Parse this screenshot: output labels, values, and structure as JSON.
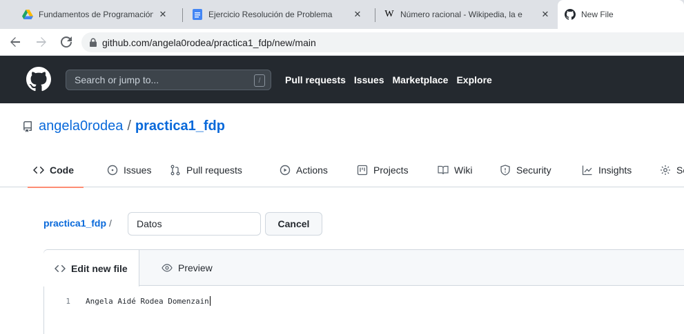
{
  "browser": {
    "tabs": [
      {
        "title": "Fundamentos de Programación -",
        "icon": "google-drive-icon"
      },
      {
        "title": "Ejercicio Resolución de Problema",
        "icon": "google-docs-icon"
      },
      {
        "title": "Número racional - Wikipedia, la e",
        "icon": "wikipedia-icon"
      },
      {
        "title": "New File",
        "icon": "github-icon"
      }
    ],
    "tab_close_glyph": "✕",
    "url": "github.com/angela0rodea/practica1_fdp/new/main"
  },
  "github_header": {
    "search_placeholder": "Search or jump to...",
    "search_shortcut": "/",
    "nav": [
      "Pull requests",
      "Issues",
      "Marketplace",
      "Explore"
    ]
  },
  "repo": {
    "owner": "angela0rodea",
    "separator": "/",
    "name": "practica1_fdp",
    "tabs": [
      {
        "label": "Code",
        "icon": "code-icon"
      },
      {
        "label": "Issues",
        "icon": "issue-opened-icon"
      },
      {
        "label": "Pull requests",
        "icon": "git-pull-request-icon"
      },
      {
        "label": "Actions",
        "icon": "play-icon"
      },
      {
        "label": "Projects",
        "icon": "project-icon"
      },
      {
        "label": "Wiki",
        "icon": "book-icon"
      },
      {
        "label": "Security",
        "icon": "shield-icon"
      },
      {
        "label": "Insights",
        "icon": "graph-icon"
      },
      {
        "label": "Se",
        "icon": "gear-icon"
      }
    ]
  },
  "editor": {
    "repo_crumb": "practica1_fdp",
    "crumb_separator": "/",
    "filename_value": "Datos",
    "cancel_label": "Cancel",
    "tabs": {
      "edit": "Edit new file",
      "preview": "Preview"
    },
    "lines": [
      {
        "number": "1",
        "text": "Angela Aidé Rodea Domenzain"
      }
    ]
  },
  "colors": {
    "github_header_bg": "#24292f",
    "link_blue": "#0969da",
    "selected_tab_underline": "#fd8c73"
  }
}
